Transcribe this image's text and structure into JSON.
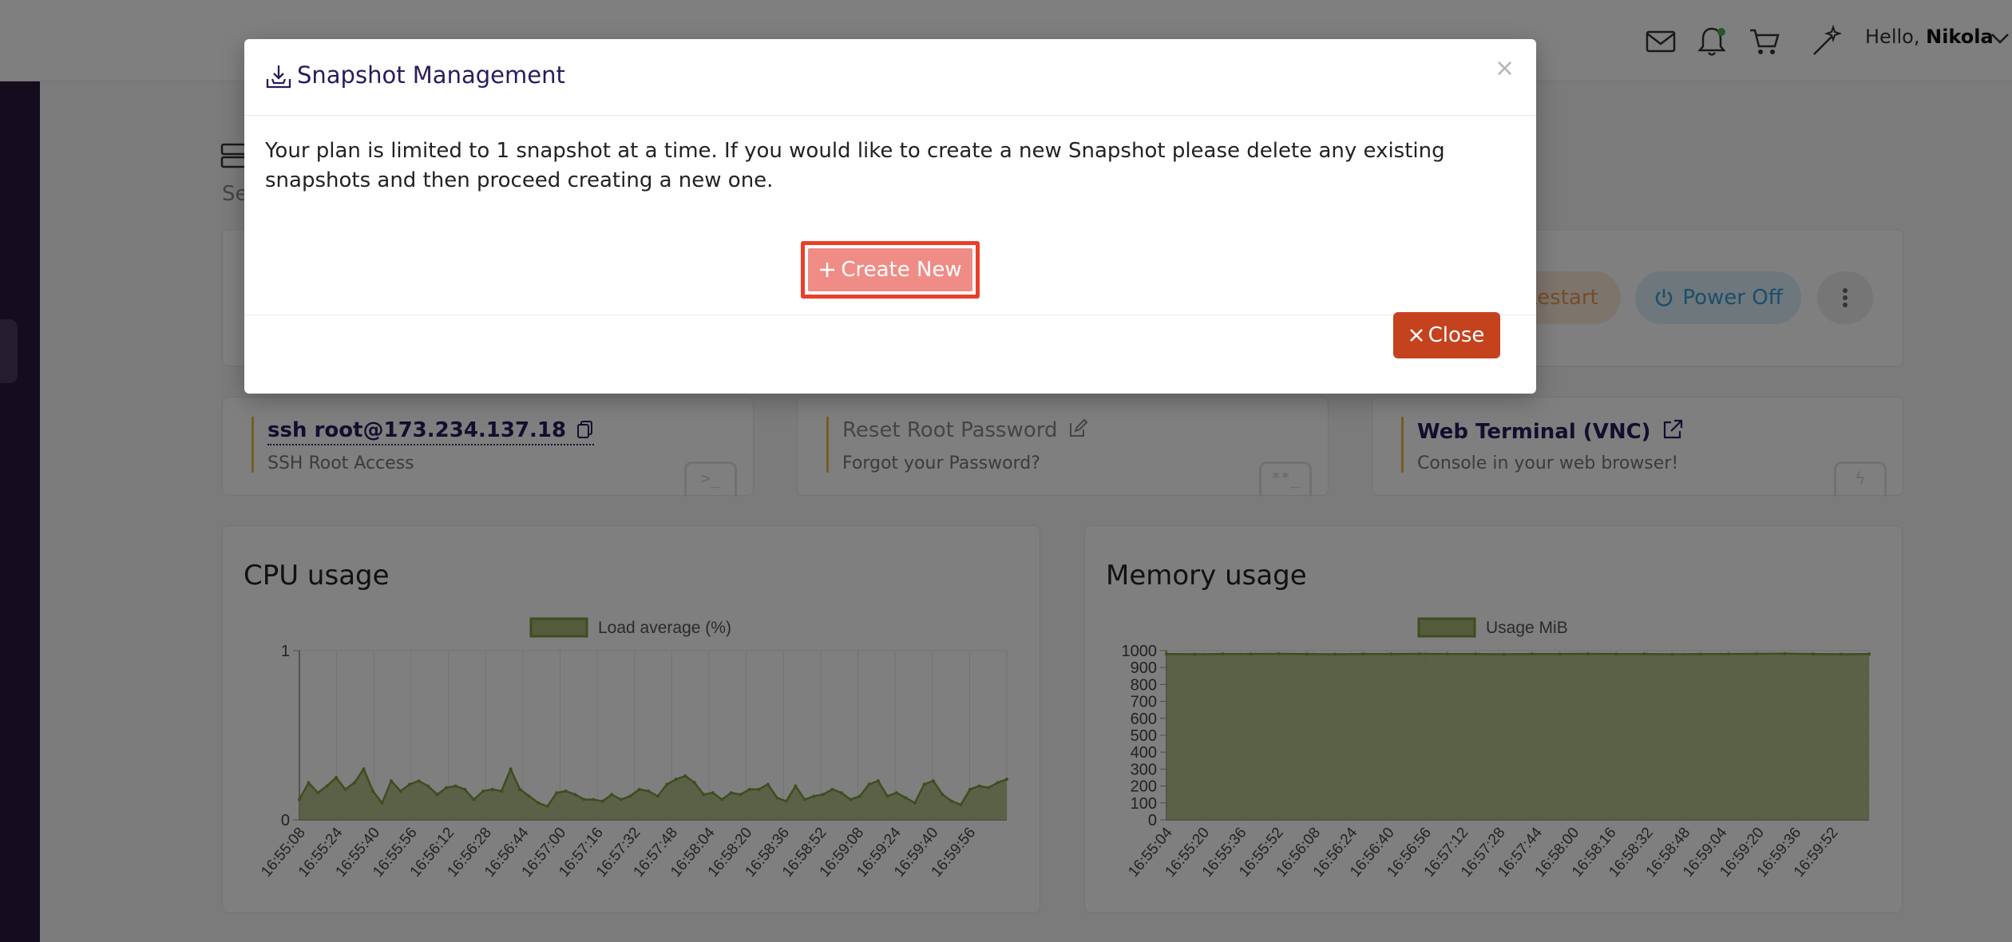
{
  "topbar": {
    "greeting_prefix": "Hello,",
    "user_name": "Nikola"
  },
  "server_header": {
    "subtitle_fragment": "Se"
  },
  "actions": {
    "restart_label": "Restart",
    "power_off_label": "Power Off"
  },
  "info_cards": [
    {
      "title": "ssh root@173.234.137.18",
      "subtitle": "SSH Root Access",
      "corner": ">_"
    },
    {
      "title": "Reset Root Password",
      "subtitle": "Forgot your Password?",
      "corner": "**_"
    },
    {
      "title": "Web Terminal (VNC)",
      "subtitle": "Console in your web browser!",
      "corner": "ϟ"
    }
  ],
  "cpu": {
    "title": "CPU usage",
    "chart_data": {
      "type": "area",
      "legend": "Load average (%)",
      "ylim": [
        0,
        1
      ],
      "yticks": [
        "0",
        "1"
      ],
      "xticks": [
        "16:55:08",
        "16:55:24",
        "16:55:40",
        "16:55:56",
        "16:56:12",
        "16:56:28",
        "16:56:44",
        "16:57:00",
        "16:57:16",
        "16:57:32",
        "16:57:48",
        "16:58:04",
        "16:58:20",
        "16:58:36",
        "16:58:52",
        "16:59:08",
        "16:59:24",
        "16:59:40",
        "16:59:56"
      ],
      "values": [
        0.12,
        0.22,
        0.16,
        0.2,
        0.25,
        0.18,
        0.22,
        0.3,
        0.17,
        0.1,
        0.23,
        0.17,
        0.21,
        0.23,
        0.2,
        0.15,
        0.19,
        0.2,
        0.18,
        0.12,
        0.17,
        0.18,
        0.17,
        0.3,
        0.18,
        0.14,
        0.1,
        0.08,
        0.16,
        0.17,
        0.15,
        0.12,
        0.12,
        0.11,
        0.15,
        0.12,
        0.14,
        0.18,
        0.17,
        0.14,
        0.21,
        0.24,
        0.26,
        0.22,
        0.15,
        0.16,
        0.12,
        0.16,
        0.15,
        0.18,
        0.18,
        0.21,
        0.13,
        0.11,
        0.2,
        0.12,
        0.14,
        0.15,
        0.18,
        0.16,
        0.12,
        0.14,
        0.21,
        0.23,
        0.14,
        0.16,
        0.13,
        0.1,
        0.21,
        0.23,
        0.15,
        0.11,
        0.09,
        0.18,
        0.2,
        0.19,
        0.22,
        0.24
      ]
    }
  },
  "memory": {
    "title": "Memory usage",
    "chart_data": {
      "type": "area",
      "legend": "Usage MiB",
      "ylim": [
        0,
        1000
      ],
      "yticks": [
        "0",
        "100",
        "200",
        "300",
        "400",
        "500",
        "600",
        "700",
        "800",
        "900",
        "1000"
      ],
      "xticks": [
        "16:55:04",
        "16:55:20",
        "16:55:36",
        "16:55:52",
        "16:56:08",
        "16:56:24",
        "16:56:40",
        "16:56:56",
        "16:57:12",
        "16:57:28",
        "16:57:44",
        "16:58:00",
        "16:58:16",
        "16:58:32",
        "16:58:48",
        "16:59:04",
        "16:59:20",
        "16:59:36",
        "16:59:52"
      ],
      "values": [
        980,
        979,
        980,
        980,
        981,
        980,
        979,
        980,
        980,
        981,
        980,
        980,
        979,
        980,
        980,
        981,
        980,
        980,
        979,
        980,
        980,
        981,
        982,
        980,
        979,
        980
      ]
    }
  },
  "modal": {
    "title": "Snapshot Management",
    "close_symbol": "×",
    "message": "Your plan is limited to 1 snapshot at a time. If you would like to create a new Snapshot please delete any existing snapshots and then proceed creating a new one.",
    "create_label": "Create New",
    "close_label": "Close"
  },
  "colors": {
    "area_fill": "#a9b97a",
    "area_stroke": "#7d9a3e",
    "primary_text": "#2a1b5c",
    "close_button": "#c4431e",
    "create_button": "#f08c86",
    "highlight": "#e8402a"
  }
}
